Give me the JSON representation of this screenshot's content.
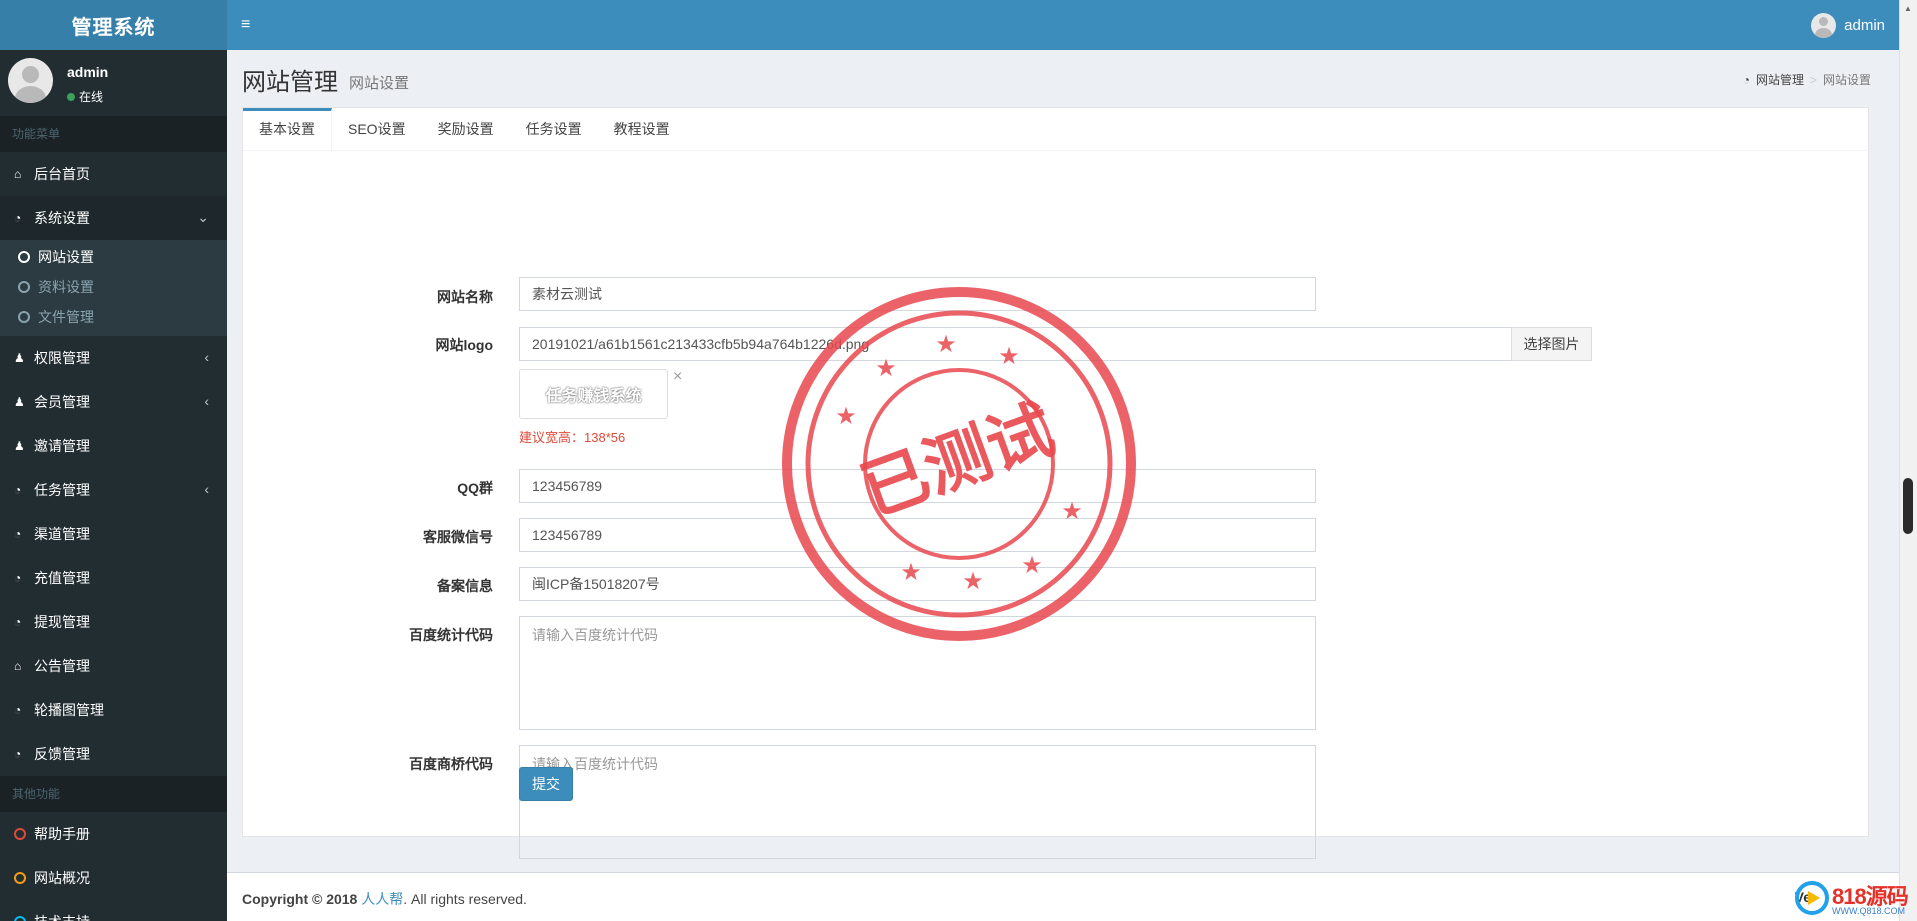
{
  "app": {
    "title": "管理系统"
  },
  "topbar": {
    "user": "admin"
  },
  "sidebar": {
    "user_name": "admin",
    "user_status": "在线",
    "header_main": "功能菜单",
    "header_other": "其他功能",
    "items": [
      {
        "label": "后台首页",
        "icon": "home-icon"
      },
      {
        "label": "系统设置",
        "icon": "dashboard-icon"
      },
      {
        "label": "权限管理",
        "icon": "users-icon"
      },
      {
        "label": "会员管理",
        "icon": "users-icon"
      },
      {
        "label": "邀请管理",
        "icon": "users-icon"
      },
      {
        "label": "任务管理",
        "icon": "dashboard-icon"
      },
      {
        "label": "渠道管理",
        "icon": "dashboard-icon"
      },
      {
        "label": "充值管理",
        "icon": "dashboard-icon"
      },
      {
        "label": "提现管理",
        "icon": "dashboard-icon"
      },
      {
        "label": "公告管理",
        "icon": "home-icon"
      },
      {
        "label": "轮播图管理",
        "icon": "dashboard-icon"
      },
      {
        "label": "反馈管理",
        "icon": "dashboard-icon"
      }
    ],
    "submenu": [
      "网站设置",
      "资料设置",
      "文件管理"
    ],
    "other": [
      "帮助手册",
      "网站概况",
      "技术支持"
    ]
  },
  "page": {
    "title": "网站管理",
    "subtitle": "网站设置",
    "breadcrumb": [
      "网站管理",
      "网站设置"
    ]
  },
  "tabs": [
    "基本设置",
    "SEO设置",
    "奖励设置",
    "任务设置",
    "教程设置"
  ],
  "form": {
    "site_name_label": "网站名称",
    "site_name_value": "素材云测试",
    "logo_label": "网站logo",
    "logo_value": "20191021/a61b1561c213433cfb5b94a764b1226d.png",
    "logo_button": "选择图片",
    "logo_preview_text": "任务赚钱系统",
    "logo_remove": "×",
    "logo_hint": "建议宽高：138*56",
    "qq_label": "QQ群",
    "qq_value": "123456789",
    "wechat_label": "客服微信号",
    "wechat_value": "123456789",
    "icp_label": "备案信息",
    "icp_value": "闽ICP备15018207号",
    "baidu_stat_label": "百度统计代码",
    "baidu_stat_placeholder": "请输入百度统计代码",
    "baidu_bridge_label": "百度商桥代码",
    "baidu_bridge_placeholder": "请输入百度统计代码",
    "submit": "提交"
  },
  "stamp": {
    "text": "已测试",
    "color": "#e8484d"
  },
  "footer": {
    "copyright_prefix": "Copyright © 2018",
    "company": "人人帮",
    "copyright_suffix": ". All rights reserved.",
    "version": "Ve"
  },
  "watermark": {
    "brand": "818源码",
    "url": "WWW.Q818.COM"
  },
  "colors": {
    "primary": "#3c8dbc",
    "sidebar": "#222d32",
    "danger": "#dd4b39"
  }
}
